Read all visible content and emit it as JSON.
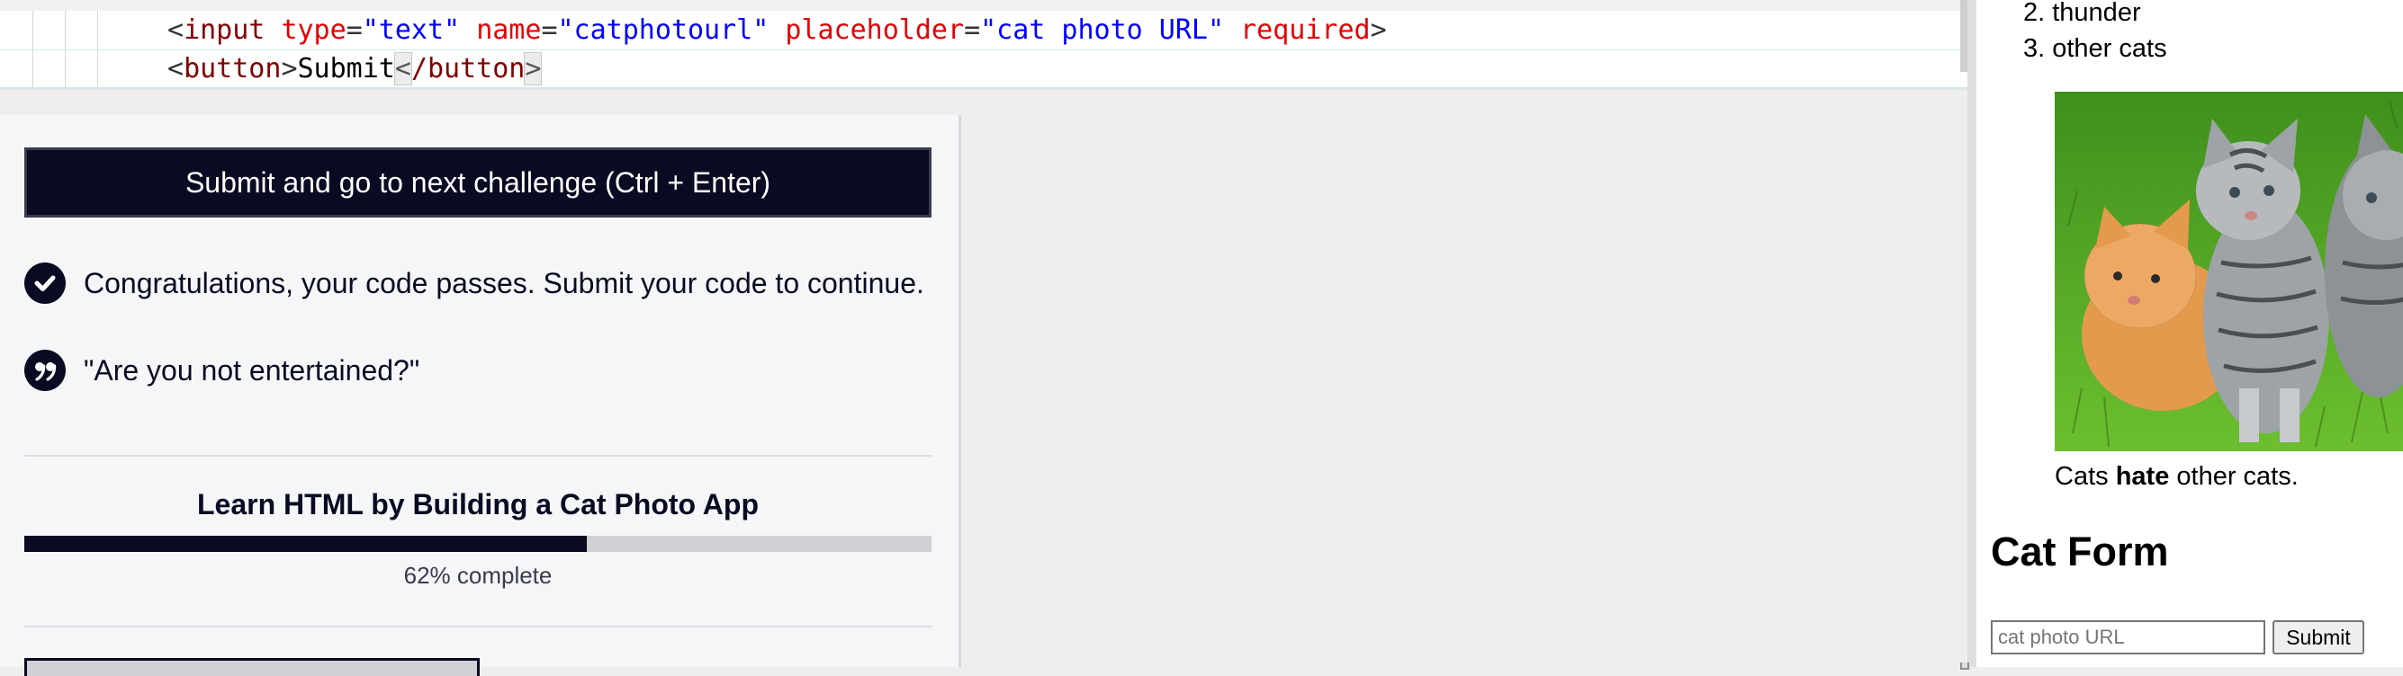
{
  "editor": {
    "line1": {
      "lt": "<",
      "tag": "input",
      "attr1": "type",
      "eq": "=",
      "val1": "\"text\"",
      "attr2": "name",
      "val2": "\"catphotourl\"",
      "attr3": "placeholder",
      "val3": "\"cat photo URL\"",
      "attr4": "required",
      "gt": ">"
    },
    "line2": {
      "lt": "<",
      "tag": "button",
      "gt": ">",
      "text": "Submit",
      "close_lt": "<",
      "close_tag": "/button",
      "close_gt": ">"
    }
  },
  "panel": {
    "submit_label": "Submit and go to next challenge (Ctrl + Enter)",
    "pass_message": "Congratulations, your code passes. Submit your code to continue.",
    "quote": "\"Are you not entertained?\"",
    "course_title": "Learn HTML by Building a Cat Photo App",
    "progress_percent": 62,
    "progress_text": "62% complete"
  },
  "preview": {
    "list_items": [
      "2. thunder",
      "3. other cats"
    ],
    "caption_before": "Cats ",
    "caption_bold": "hate",
    "caption_after": " other cats.",
    "form_heading": "Cat Form",
    "input_placeholder": "cat photo URL",
    "button_label": "Submit"
  },
  "colors": {
    "accent": "#0a0a23",
    "tag": "#800000",
    "attribute": "#e50000",
    "value": "#0000ff"
  },
  "icons": [
    "check-circle-icon",
    "quote-icon",
    "kittens-image"
  ]
}
